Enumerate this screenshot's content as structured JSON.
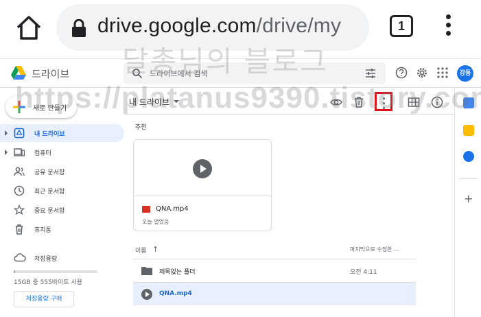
{
  "browser": {
    "url_host": "drive.google.com",
    "url_path": "/drive/my",
    "tab_count": "1"
  },
  "watermarks": {
    "line1": "달총님의 블로그",
    "line2": "https://platanus9390.tistory.com"
  },
  "header": {
    "app_name": "드라이브",
    "search_placeholder": "드라이브에서 검색",
    "avatar_text": "강동"
  },
  "sidebar": {
    "new_label": "새로 만들기",
    "items": [
      {
        "label": "내 드라이브",
        "icon": "drive-icon"
      },
      {
        "label": "컴퓨터",
        "icon": "computer-icon"
      },
      {
        "label": "공유 문서함",
        "icon": "shared-icon"
      },
      {
        "label": "최근 문서함",
        "icon": "clock-icon"
      },
      {
        "label": "중요 문서함",
        "icon": "star-icon"
      },
      {
        "label": "휴지통",
        "icon": "trash-icon"
      }
    ],
    "storage_label": "저장용량",
    "storage_used": "15GB 중 555바이트 사용",
    "storage_fraction": 0.02,
    "buy_label": "저장용량 구매"
  },
  "main": {
    "breadcrumb": "내 드라이브",
    "recommended_title": "추천",
    "card": {
      "name": "QNA.mp4",
      "sub": "오늘 열었음"
    },
    "col_name": "이름",
    "col_sort_arrow": "↑",
    "col_modified": "마지막으로 수정한 ...",
    "rows": [
      {
        "name": "제목없는 폴더",
        "date": "오전 4:11",
        "type": "folder"
      },
      {
        "name": "QNA.mp4",
        "date": "",
        "type": "video"
      }
    ]
  },
  "colors": {
    "accent": "#1a73e8",
    "highlight_box": "#e0101a",
    "selected_bg": "#e8f0fe"
  }
}
